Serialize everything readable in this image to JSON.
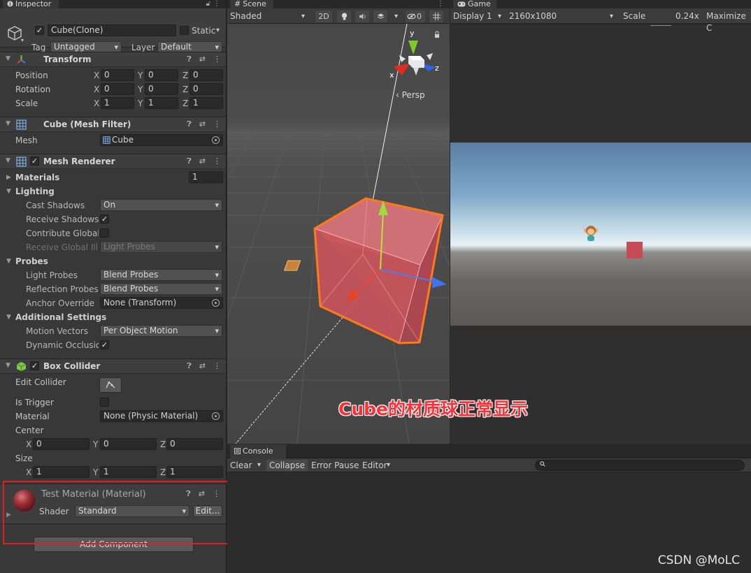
{
  "inspector": {
    "tab": "Inspector",
    "object_name": "Cube(Clone)",
    "static_label": "Static",
    "tag_label": "Tag",
    "tag_value": "Untagged",
    "layer_label": "Layer",
    "layer_value": "Default",
    "transform": {
      "title": "Transform",
      "rows": [
        {
          "label": "Position",
          "x": "0",
          "y": "0",
          "z": "0"
        },
        {
          "label": "Rotation",
          "x": "0",
          "y": "0",
          "z": "0"
        },
        {
          "label": "Scale",
          "x": "1",
          "y": "1",
          "z": "1"
        }
      ]
    },
    "mesh_filter": {
      "title": "Cube (Mesh Filter)",
      "mesh_label": "Mesh",
      "mesh_value": "Cube"
    },
    "mesh_renderer": {
      "title": "Mesh Renderer",
      "materials_label": "Materials",
      "materials_count": "1",
      "lighting_label": "Lighting",
      "cast_shadows_label": "Cast Shadows",
      "cast_shadows_value": "On",
      "receive_shadows_label": "Receive Shadows",
      "contribute_gi_label": "Contribute Global I",
      "receive_gi_label": "Receive Global Illu",
      "receive_gi_value": "Light Probes",
      "probes_label": "Probes",
      "light_probes_label": "Light Probes",
      "light_probes_value": "Blend Probes",
      "reflection_probes_label": "Reflection Probes",
      "reflection_probes_value": "Blend Probes",
      "anchor_override_label": "Anchor Override",
      "anchor_override_value": "None (Transform)",
      "additional_label": "Additional Settings",
      "motion_vectors_label": "Motion Vectors",
      "motion_vectors_value": "Per Object Motion",
      "dynamic_occlusion_label": "Dynamic Occlusio"
    },
    "box_collider": {
      "title": "Box Collider",
      "edit_collider_label": "Edit Collider",
      "is_trigger_label": "Is Trigger",
      "material_label": "Material",
      "material_value": "None (Physic Material)",
      "center_label": "Center",
      "center": {
        "x": "0",
        "y": "0",
        "z": "0"
      },
      "size_label": "Size",
      "size": {
        "x": "1",
        "y": "1",
        "z": "1"
      }
    },
    "material": {
      "title": "Test Material (Material)",
      "shader_label": "Shader",
      "shader_value": "Standard",
      "edit_label": "Edit..."
    },
    "add_component": "Add Component"
  },
  "scene": {
    "tab": "Scene",
    "shading": "Shaded",
    "mode_2d": "2D",
    "hidden_count": "0",
    "gizmo_labels": {
      "x": "x",
      "y": "y",
      "z": "z"
    },
    "persp": "Persp"
  },
  "game": {
    "tab": "Game",
    "display": "Display 1",
    "resolution": "2160x1080",
    "scale_label": "Scale",
    "scale_value": "0.24x",
    "maximize": "Maximize C"
  },
  "console": {
    "tab": "Console",
    "clear": "Clear",
    "collapse": "Collapse",
    "error_pause": "Error Pause",
    "editor": "Editor"
  },
  "annotation": "Cube的材质球正常显示",
  "watermark": "CSDN @MoLC",
  "colors": {
    "highlight_box": "#e0201f",
    "annotation_text": "#ff3035",
    "cube_face": "#c9545c",
    "selection_outline": "#ff7a1a"
  }
}
